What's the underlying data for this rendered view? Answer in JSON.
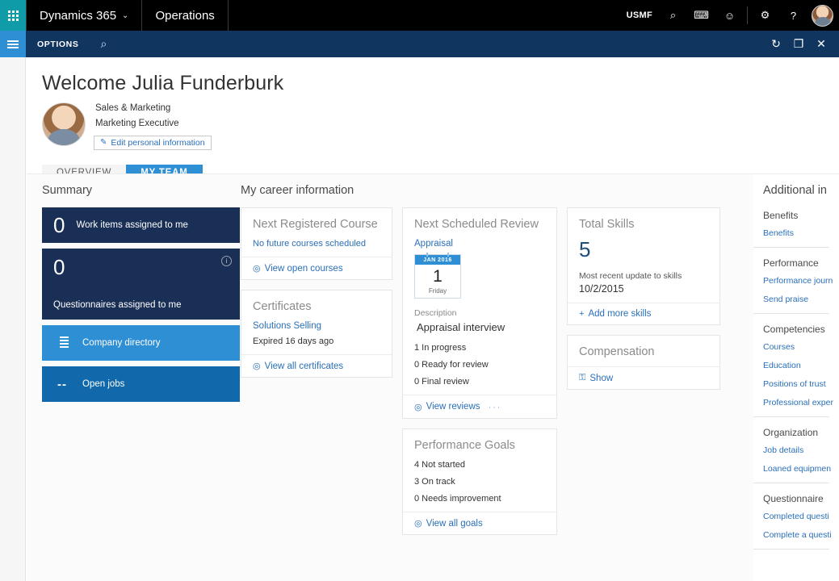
{
  "appbar": {
    "waffle_icon": "app-launcher-grid-icon",
    "brand": "Dynamics 365",
    "brand_chevron": "⌄",
    "module": "Operations",
    "company": "USMF",
    "search_icon": "⌕",
    "chat_icon": "⌨",
    "feedback_icon": "☺",
    "settings_icon": "⚙",
    "help_icon": "?"
  },
  "cmdbar": {
    "options_label": "OPTIONS",
    "search_icon": "⌕",
    "refresh_icon": "↻",
    "popout_icon": "❐",
    "close_icon": "✕"
  },
  "header": {
    "welcome": "Welcome Julia Funderburk",
    "department": "Sales & Marketing",
    "job_title": "Marketing Executive",
    "edit_link": "Edit personal information",
    "pencil_icon": "✎"
  },
  "tabs": [
    {
      "label": "OVERVIEW",
      "active": false
    },
    {
      "label": "MY TEAM",
      "active": true
    }
  ],
  "summary": {
    "title": "Summary",
    "tiles": [
      {
        "number": "0",
        "label": "Work items assigned to me",
        "style": "dark",
        "tall": false
      },
      {
        "number": "0",
        "label": "Questionnaires assigned to me",
        "style": "dark",
        "tall": true,
        "badge": "i"
      },
      {
        "icon": "list-icon",
        "label": "Company directory",
        "style": "lightblue"
      },
      {
        "icon": "dashes-icon",
        "label": "Open jobs",
        "style": "midblue"
      }
    ]
  },
  "career": {
    "title": "My career information",
    "next_course": {
      "title": "Next Registered Course",
      "status": "No future courses scheduled",
      "link": "View open courses",
      "link_icon": "◎"
    },
    "certificates": {
      "title": "Certificates",
      "name": "Solutions Selling",
      "status": "Expired 16 days ago",
      "link": "View all certificates",
      "link_icon": "◎"
    },
    "next_review": {
      "title": "Next Scheduled Review",
      "type": "Appraisal",
      "calendar_month": "JAN 2016",
      "calendar_day": "1",
      "calendar_dow": "Friday",
      "description_label": "Description",
      "description_value": "Appraisal interview",
      "counts": [
        "1 In progress",
        "0 Ready for review",
        "0 Final review"
      ],
      "link": "View reviews",
      "link_icon": "◎",
      "more_icon": "···"
    },
    "performance_goals": {
      "title": "Performance Goals",
      "counts": [
        "4 Not started",
        "3 On track",
        "0 Needs improvement"
      ],
      "link": "View all goals",
      "link_icon": "◎"
    },
    "total_skills": {
      "title": "Total Skills",
      "value": "5",
      "label": "Most recent update to skills",
      "date": "10/2/2015",
      "link": "Add more skills",
      "link_icon": "+"
    },
    "compensation": {
      "title": "Compensation",
      "link": "Show",
      "link_icon": "⚿"
    }
  },
  "additional": {
    "title": "Additional in",
    "groups": [
      {
        "head": "Benefits",
        "links": [
          "Benefits"
        ]
      },
      {
        "head": "Performance",
        "links": [
          "Performance journ",
          "Send praise"
        ]
      },
      {
        "head": "Competencies",
        "links": [
          "Courses",
          "Education",
          "Positions of trust",
          "Professional exper"
        ]
      },
      {
        "head": "Organization",
        "links": [
          "Job details",
          "Loaned equipmen"
        ]
      },
      {
        "head": "Questionnaire",
        "links": [
          "Completed questi",
          "Complete a questi"
        ]
      }
    ]
  },
  "colors": {
    "accent_blue": "#2e8fd4",
    "dark_navy": "#10355f",
    "tile_dark": "#1a2f56",
    "tile_mid": "#1169ab",
    "link_blue": "#2a6fb8",
    "teal": "#0f9ba8"
  }
}
